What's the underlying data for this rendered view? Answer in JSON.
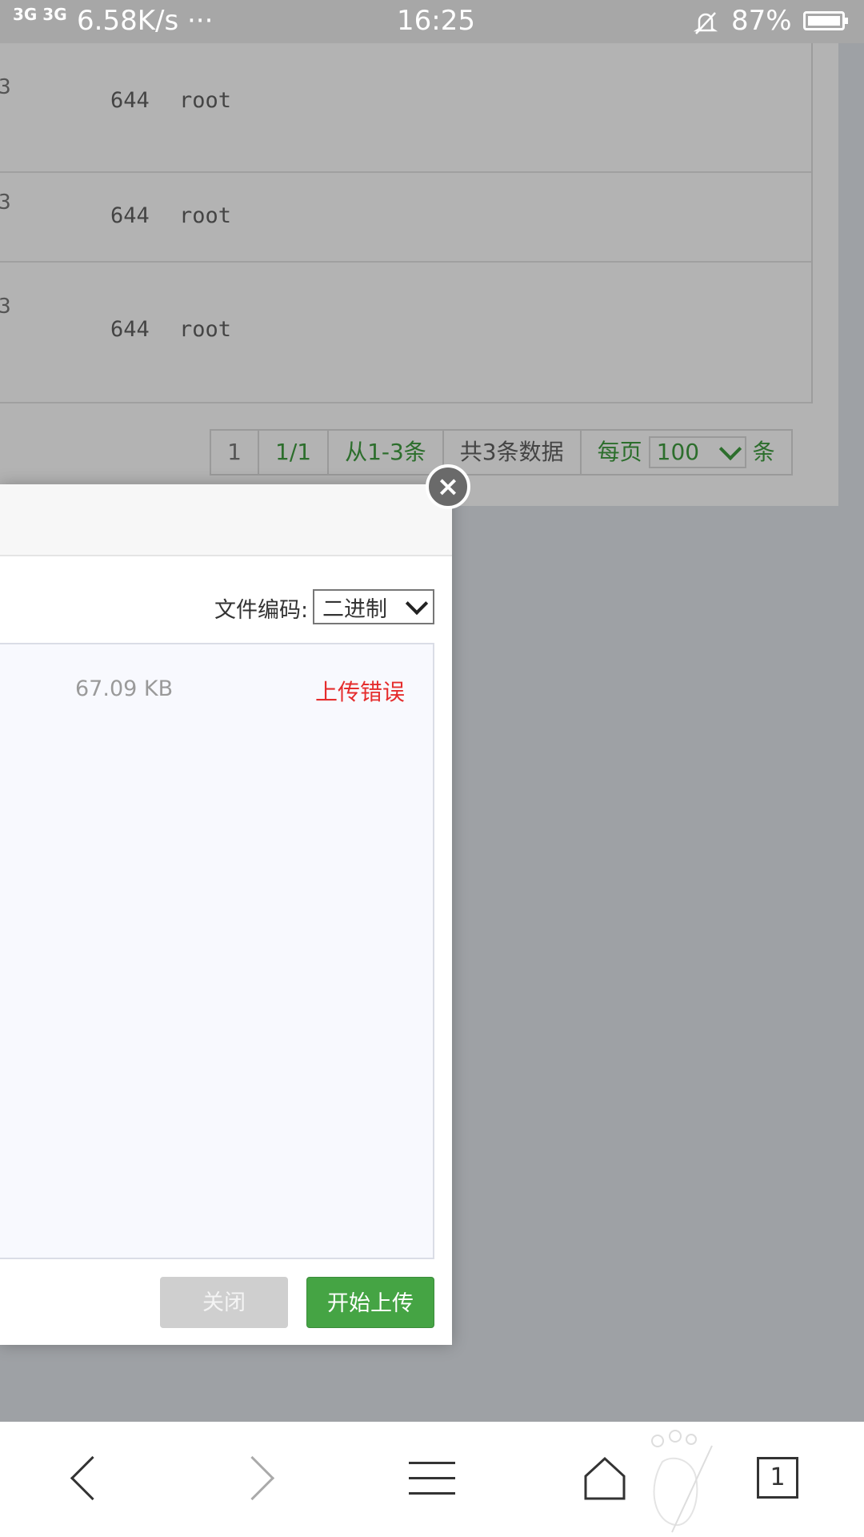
{
  "status_bar": {
    "signal": "3G 3G",
    "network_speed": "6.58K/s ···",
    "time": "16:25",
    "battery_percent": "87%",
    "icons": [
      "signal-icon",
      "mute-bell-icon",
      "battery-icon"
    ]
  },
  "background_table": {
    "rows": [
      {
        "cut_text": "3",
        "perm": "644",
        "owner": "root"
      },
      {
        "cut_text": "3",
        "perm": "644",
        "owner": "root"
      },
      {
        "cut_text": "3",
        "perm": "644",
        "owner": "root"
      }
    ]
  },
  "pagination": {
    "current_page": "1",
    "page_of": "1/1",
    "range": "从1-3条",
    "total": "共3条数据",
    "per_page_prefix": "每页",
    "per_page_value": "100",
    "per_page_suffix": "条"
  },
  "upload_dialog": {
    "encoding_label": "文件编码:",
    "encoding_value": "二进制",
    "file": {
      "size": "67.09 KB",
      "status": "上传错误"
    },
    "close_button": "关闭",
    "start_button": "开始上传",
    "close_icon": "×"
  },
  "browser_bar": {
    "tabs_count": "1",
    "icons": [
      "back-icon",
      "forward-icon",
      "menu-icon",
      "home-icon",
      "footprint-icon",
      "tabs-icon"
    ]
  },
  "colors": {
    "accent_green": "#45a444",
    "error_red": "#e52d2d",
    "pager_green": "#2c6e2c"
  }
}
